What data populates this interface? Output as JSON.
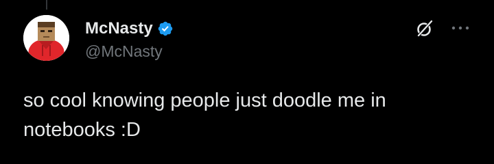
{
  "tweet": {
    "author": {
      "display_name": "McNasty",
      "handle": "@McNasty",
      "verified": true
    },
    "text": "so cool knowing people just doodle me in notebooks :D"
  },
  "icons": {
    "verified": "verified-badge-icon",
    "grok": "grok-icon",
    "more": "more-options-icon"
  },
  "colors": {
    "background": "#000000",
    "primary_text": "#e7e9ea",
    "secondary_text": "#71767b",
    "verified_blue": "#1d9bf0",
    "avatar_hoodie": "#e0262b"
  }
}
